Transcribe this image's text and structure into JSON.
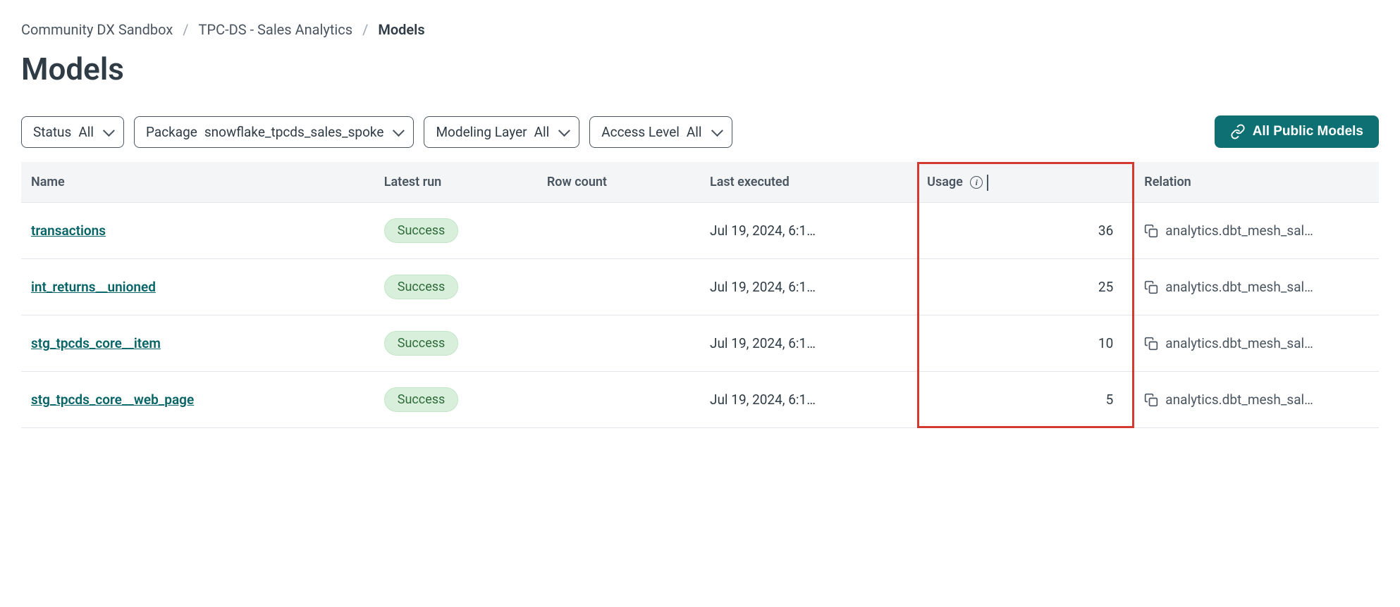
{
  "breadcrumb": {
    "item0": "Community DX Sandbox",
    "item1": "TPC-DS - Sales Analytics",
    "item2": "Models"
  },
  "page_title": "Models",
  "filters": {
    "status": {
      "label": "Status",
      "value": "All"
    },
    "package": {
      "label": "Package",
      "value": "snowflake_tpcds_sales_spoke"
    },
    "modeling_layer": {
      "label": "Modeling Layer",
      "value": "All"
    },
    "access_level": {
      "label": "Access Level",
      "value": "All"
    }
  },
  "public_models_btn": "All Public Models",
  "columns": {
    "name": "Name",
    "latest_run": "Latest run",
    "row_count": "Row count",
    "last_executed": "Last executed",
    "usage": "Usage",
    "relation": "Relation"
  },
  "rows": [
    {
      "name": "transactions",
      "latest_run": "Success",
      "row_count": "",
      "last_executed": "Jul 19, 2024, 6:1…",
      "usage": "36",
      "relation": "analytics.dbt_mesh_sal…"
    },
    {
      "name": "int_returns__unioned",
      "latest_run": "Success",
      "row_count": "",
      "last_executed": "Jul 19, 2024, 6:1…",
      "usage": "25",
      "relation": "analytics.dbt_mesh_sal…"
    },
    {
      "name": "stg_tpcds_core__item",
      "latest_run": "Success",
      "row_count": "",
      "last_executed": "Jul 19, 2024, 6:1…",
      "usage": "10",
      "relation": "analytics.dbt_mesh_sal…"
    },
    {
      "name": "stg_tpcds_core__web_page",
      "latest_run": "Success",
      "row_count": "",
      "last_executed": "Jul 19, 2024, 6:1…",
      "usage": "5",
      "relation": "analytics.dbt_mesh_sal…"
    }
  ]
}
